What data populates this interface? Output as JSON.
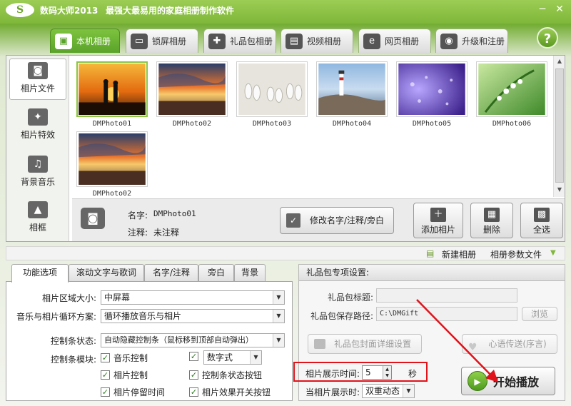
{
  "titlebar": {
    "logo": "S",
    "app_name": "数码大师2013",
    "slogan": "最强大最易用的家庭相册制作软件",
    "minimize": "─",
    "close": "✕"
  },
  "tabs": [
    {
      "label": "本机相册",
      "icon": "photo-album-icon",
      "glyph": "▣"
    },
    {
      "label": "锁屏相册",
      "icon": "monitor-icon",
      "glyph": "▭"
    },
    {
      "label": "礼品包相册",
      "icon": "gift-icon",
      "glyph": "✚"
    },
    {
      "label": "视频相册",
      "icon": "film-icon",
      "glyph": "▤"
    },
    {
      "label": "网页相册",
      "icon": "ie-browser-icon",
      "glyph": "e"
    },
    {
      "label": "升级和注册",
      "icon": "globe-icon",
      "glyph": "◉"
    }
  ],
  "help": "?",
  "leftnav": [
    {
      "label": "相片文件",
      "icon": "camera-icon",
      "glyph": "◙"
    },
    {
      "label": "相片特效",
      "icon": "effects-icon",
      "glyph": "✦"
    },
    {
      "label": "背景音乐",
      "icon": "music-note-icon",
      "glyph": "♫"
    },
    {
      "label": "相框",
      "icon": "picture-frame-icon",
      "glyph": "▲"
    }
  ],
  "photos": [
    {
      "name": "DMPhoto01",
      "scene": "sunset-couple"
    },
    {
      "name": "DMPhoto02",
      "scene": "sunset-sea"
    },
    {
      "name": "DMPhoto03",
      "scene": "shoes-sand"
    },
    {
      "name": "DMPhoto04",
      "scene": "lighthouse"
    },
    {
      "name": "DMPhoto05",
      "scene": "purple-drops"
    },
    {
      "name": "DMPhoto06",
      "scene": "green-flowers"
    },
    {
      "name": "DMPhoto02",
      "scene": "sunset-sea"
    }
  ],
  "info": {
    "name_label": "名字:",
    "name_value": "DMPhoto01",
    "note_label": "注释:",
    "note_value": "未注释"
  },
  "buttons": {
    "edit_name": "修改名字/注释/旁白",
    "add_photo": "添加相片",
    "delete": "删除",
    "select_all": "全选"
  },
  "pathbar": {
    "new_album": "新建相册",
    "album_params": "相册参数文件"
  },
  "option_tabs": [
    "功能选项",
    "滚动文字与歌词",
    "名字/注释",
    "旁白",
    "背景"
  ],
  "options": {
    "area_size_label": "相片区域大小:",
    "area_size_value": "中屏幕",
    "loop_label": "音乐与相片循环方案:",
    "loop_value": "循环播放音乐与相片",
    "controlbar_state_label": "控制条状态:",
    "controlbar_state_value": "自动隐藏控制条（鼠标移到顶部自动弹出）",
    "controlbar_module_label": "控制条模块:",
    "music_control": "音乐控制",
    "digital_style": "数字式",
    "photo_control": "相片控制",
    "status_button": "控制条状态按钮",
    "stay_time": "相片停留时间",
    "effect_switch": "相片效果开关按钮",
    "check": "✓"
  },
  "gift": {
    "title": "礼品包专项设置:",
    "package_title_label": "礼品包标题:",
    "package_title_value": "",
    "save_path_label": "礼品包保存路径:",
    "save_path_value": "C:\\DMGift",
    "browse": "浏览",
    "cover_settings": "礼品包封面详细设置",
    "heart_message": "心语传送(序言)"
  },
  "display": {
    "time_label": "相片展示时间:",
    "time_value": "5",
    "time_unit": "秒",
    "when_label": "当相片展示时:",
    "when_value": "双重动态"
  },
  "play": {
    "label": "开始播放",
    "glyph": "▶"
  },
  "colors": {
    "accent_green": "#7fb83a",
    "highlight_red": "#e0121a"
  }
}
